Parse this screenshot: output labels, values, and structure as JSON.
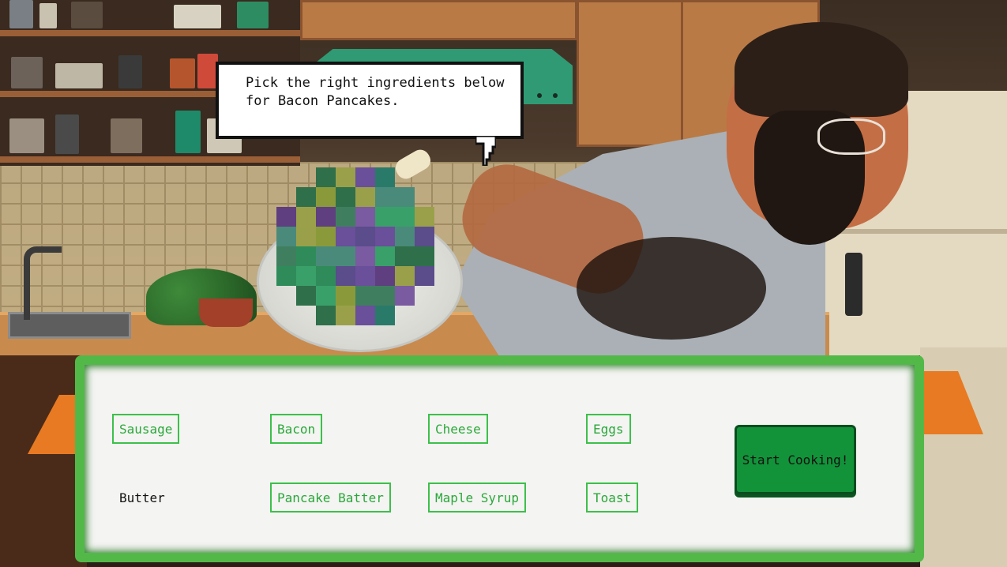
{
  "dialog": {
    "text": "Pick the right ingredients below\nfor Bacon Pancakes."
  },
  "ingredients": [
    {
      "label": "Sausage",
      "style": "boxed"
    },
    {
      "label": "Bacon",
      "style": "boxed"
    },
    {
      "label": "Cheese",
      "style": "boxed"
    },
    {
      "label": "Eggs",
      "style": "boxed"
    },
    {
      "label": "Butter",
      "style": "plain"
    },
    {
      "label": "Pancake Batter",
      "style": "boxed"
    },
    {
      "label": "Maple Syrup",
      "style": "boxed"
    },
    {
      "label": "Toast",
      "style": "boxed"
    }
  ],
  "actions": {
    "start_label": "Start Cooking!"
  },
  "colors": {
    "panel_border": "#52b949",
    "button_bg": "#12933a",
    "ingredient_outline": "#3cc04a"
  }
}
